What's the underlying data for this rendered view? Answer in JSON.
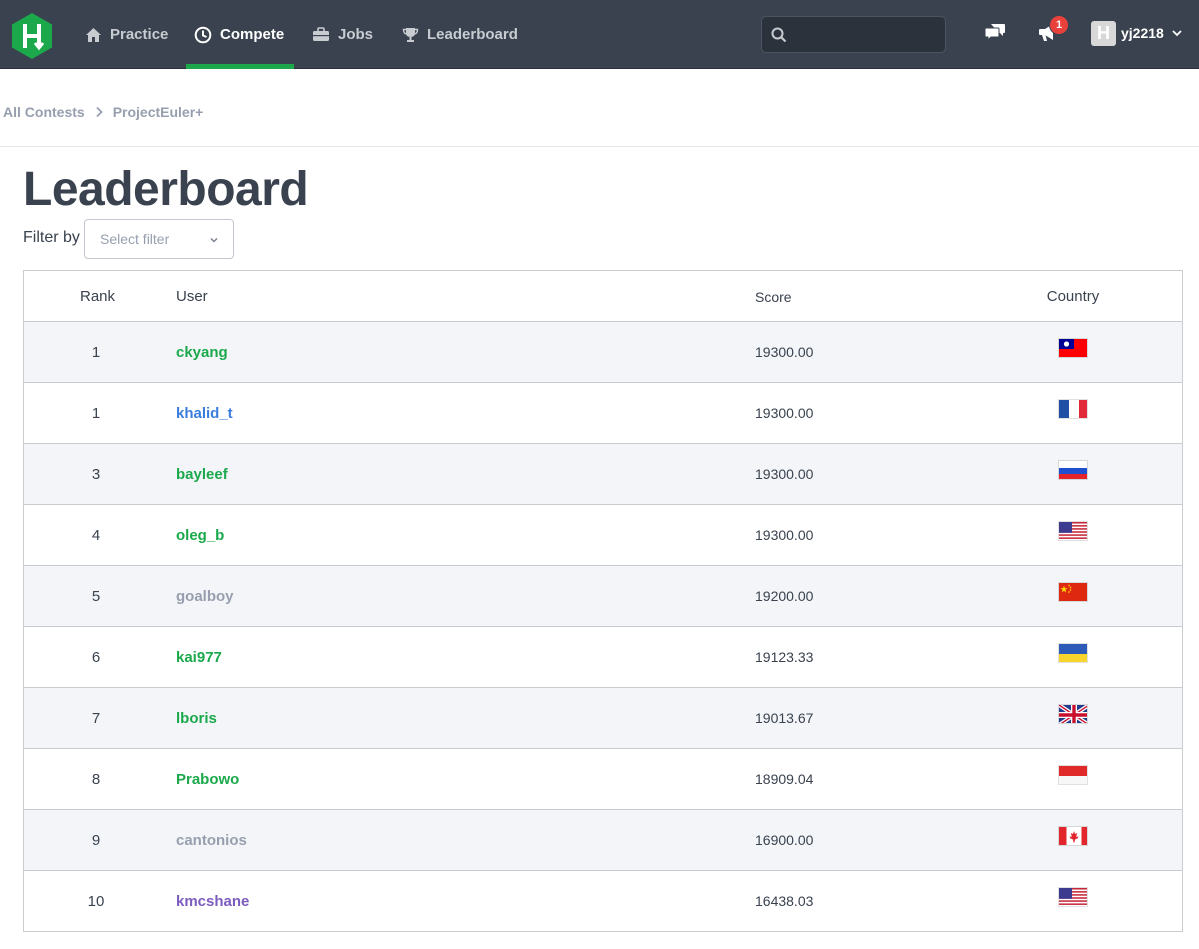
{
  "nav": {
    "items": [
      {
        "label": "Practice",
        "icon": "home-icon"
      },
      {
        "label": "Compete",
        "icon": "clock-icon",
        "active": true
      },
      {
        "label": "Jobs",
        "icon": "briefcase-icon"
      },
      {
        "label": "Leaderboard",
        "icon": "trophy-icon"
      }
    ],
    "search": {
      "value": "",
      "placeholder": ""
    },
    "notifications_count": "1",
    "username": "yj2218",
    "avatar_letter": "H"
  },
  "breadcrumb": {
    "items": [
      "All Contests",
      "ProjectEuler+"
    ]
  },
  "page": {
    "title": "Leaderboard",
    "filter_label": "Filter by",
    "filter_placeholder": "Select filter"
  },
  "table": {
    "headers": {
      "rank": "Rank",
      "user": "User",
      "score": "Score",
      "country": "Country"
    },
    "rows": [
      {
        "rank": "1",
        "user": "ckyang",
        "score": "19300.00",
        "country_flag": "taiwan-flag",
        "user_color": "#1ba94c"
      },
      {
        "rank": "1",
        "user": "khalid_t",
        "score": "19300.00",
        "country_flag": "france-flag",
        "user_color": "#3b7ddd"
      },
      {
        "rank": "3",
        "user": "bayleef",
        "score": "19300.00",
        "country_flag": "russia-flag",
        "user_color": "#1ba94c"
      },
      {
        "rank": "4",
        "user": "oleg_b",
        "score": "19300.00",
        "country_flag": "usa-flag",
        "user_color": "#1ba94c"
      },
      {
        "rank": "5",
        "user": "goalboy",
        "score": "19200.00",
        "country_flag": "china-flag",
        "user_color": "#979faf"
      },
      {
        "rank": "6",
        "user": "kai977",
        "score": "19123.33",
        "country_flag": "ukraine-flag",
        "user_color": "#1ba94c"
      },
      {
        "rank": "7",
        "user": "lboris",
        "score": "19013.67",
        "country_flag": "uk-flag",
        "user_color": "#1ba94c"
      },
      {
        "rank": "8",
        "user": "Prabowo",
        "score": "18909.04",
        "country_flag": "indonesia-flag",
        "user_color": "#1ba94c"
      },
      {
        "rank": "9",
        "user": "cantonios",
        "score": "16900.00",
        "country_flag": "canada-flag",
        "user_color": "#979faf"
      },
      {
        "rank": "10",
        "user": "kmcshane",
        "score": "16438.03",
        "country_flag": "usa-flag",
        "user_color": "#7c5cbf"
      }
    ]
  },
  "colors": {
    "topbar": "#39424e",
    "accent_green": "#1ba94c",
    "row_alt": "#f3f5f8"
  }
}
